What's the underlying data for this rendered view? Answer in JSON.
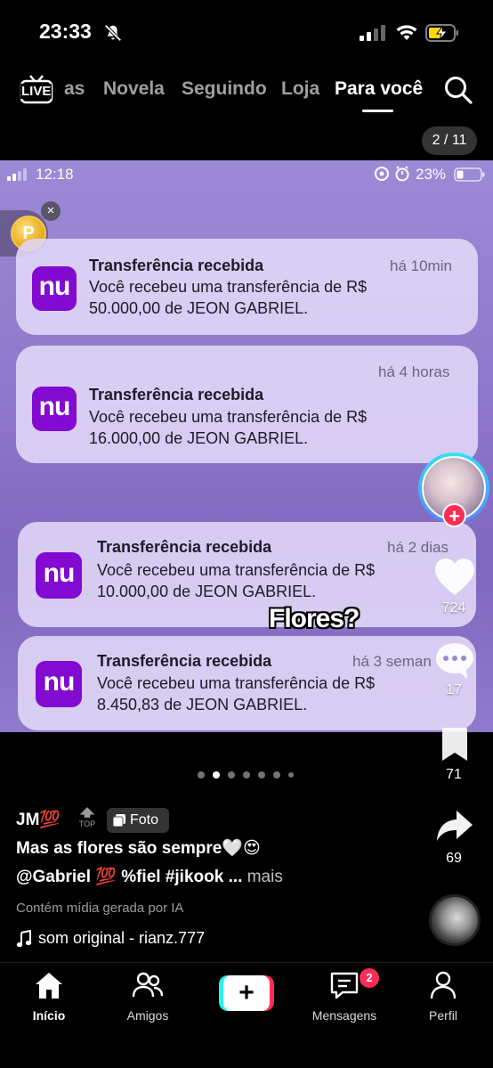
{
  "status_bar": {
    "time": "23:33"
  },
  "top_nav": {
    "live_label": "LIVE",
    "tabs": [
      "as",
      "Novela",
      "Seguindo",
      "Loja",
      "Para você"
    ],
    "active_tab": "Para você"
  },
  "page_counter": "2 / 11",
  "photo": {
    "inner_status": {
      "time": "12:18",
      "battery": "23%"
    },
    "coin_label": "P",
    "notifications": [
      {
        "app": "nu",
        "title": "Transferência recebida",
        "time": "há 10min",
        "body_line1": "Você recebeu uma transferência de R$",
        "body_line2": "50.000,00 de JEON GABRIEL."
      },
      {
        "app": "nu",
        "title": "Transferência recebida",
        "time": "há 4 horas",
        "body_line1": "Você recebeu uma transferência de R$",
        "body_line2": "16.000,00 de JEON GABRIEL."
      },
      {
        "app": "nu",
        "title": "Transferência recebida",
        "time": "há 2 dias",
        "body_line1": "Você recebeu uma transferência de R$",
        "body_line2": "10.000,00 de JEON GABRIEL."
      },
      {
        "app": "nu",
        "title": "Transferência recebida",
        "time": "há 3 seman",
        "body_line1": "Você recebeu uma transferência de R$",
        "body_line2": "8.450,83 de JEON GABRIEL."
      }
    ],
    "caption_sticker": "Flores?"
  },
  "rail": {
    "likes": "724",
    "comments": "17",
    "saves": "71",
    "shares": "69"
  },
  "carousel": {
    "count": 7,
    "active_index": 1
  },
  "post": {
    "author": "JM💯",
    "top_badge": "TOP",
    "photo_badge": "Foto",
    "desc_line1": "Mas as flores são sempre🤍😍",
    "desc_line2": "@Gabriel 💯 %fiel #jikook ...",
    "more": "mais",
    "ai_label": "Contém mídia gerada por IA",
    "sound": "som original - rianz.777"
  },
  "bottom_nav": {
    "items": [
      "Início",
      "Amigos",
      "",
      "Mensagens",
      "Perfil"
    ],
    "create_label": "+",
    "messages_badge": "2"
  },
  "colors": {
    "accent": "#fe2c55",
    "nubank": "#820ad1",
    "cyan": "#25f4ee"
  }
}
